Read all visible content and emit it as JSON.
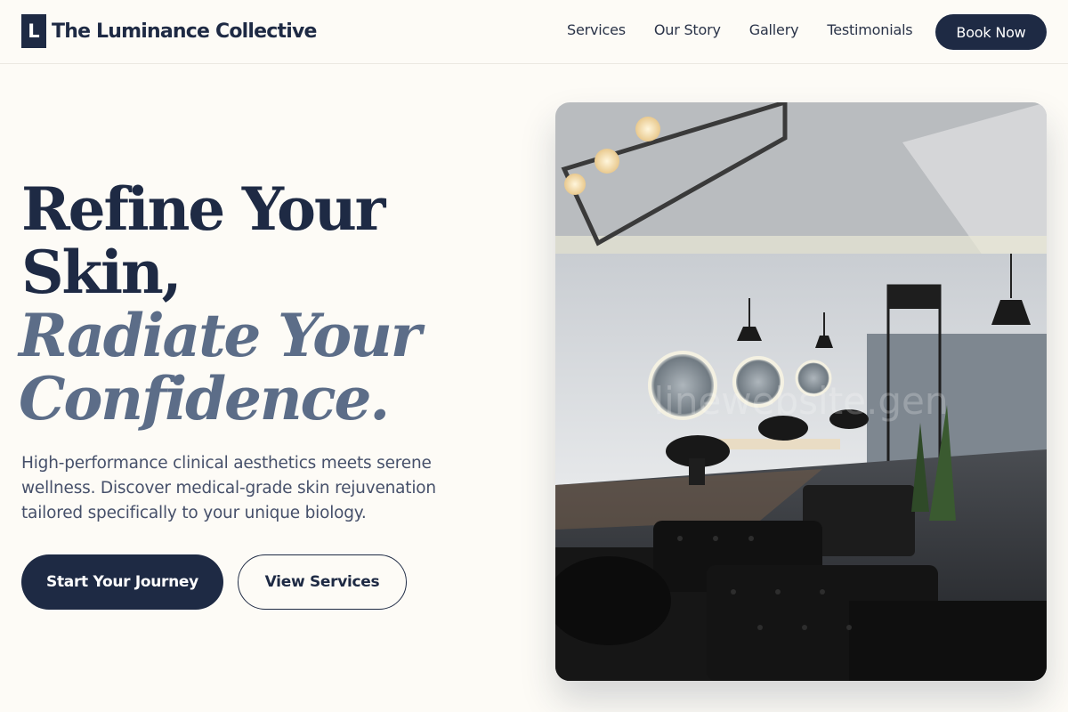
{
  "brand": {
    "mark": "L",
    "name": "The Luminance Collective"
  },
  "nav": {
    "links": [
      "Services",
      "Our Story",
      "Gallery",
      "Testimonials"
    ],
    "book_label": "Book Now"
  },
  "hero": {
    "headline_line1": "Refine Your",
    "headline_line2": "Skin,",
    "headline_line3": "Radiate Your",
    "headline_line4": "Confidence.",
    "subtitle": "High-performance clinical aesthetics meets serene wellness. Discover medical-grade skin rejuvenation tailored specifically to your unique biology.",
    "primary_cta": "Start Your Journey",
    "secondary_cta": "View Services",
    "image_watermark": "linewebsite.gen"
  },
  "colors": {
    "navy": "#1e2a44",
    "slate_accent": "#5c6d88",
    "background": "#fdfbf6"
  }
}
